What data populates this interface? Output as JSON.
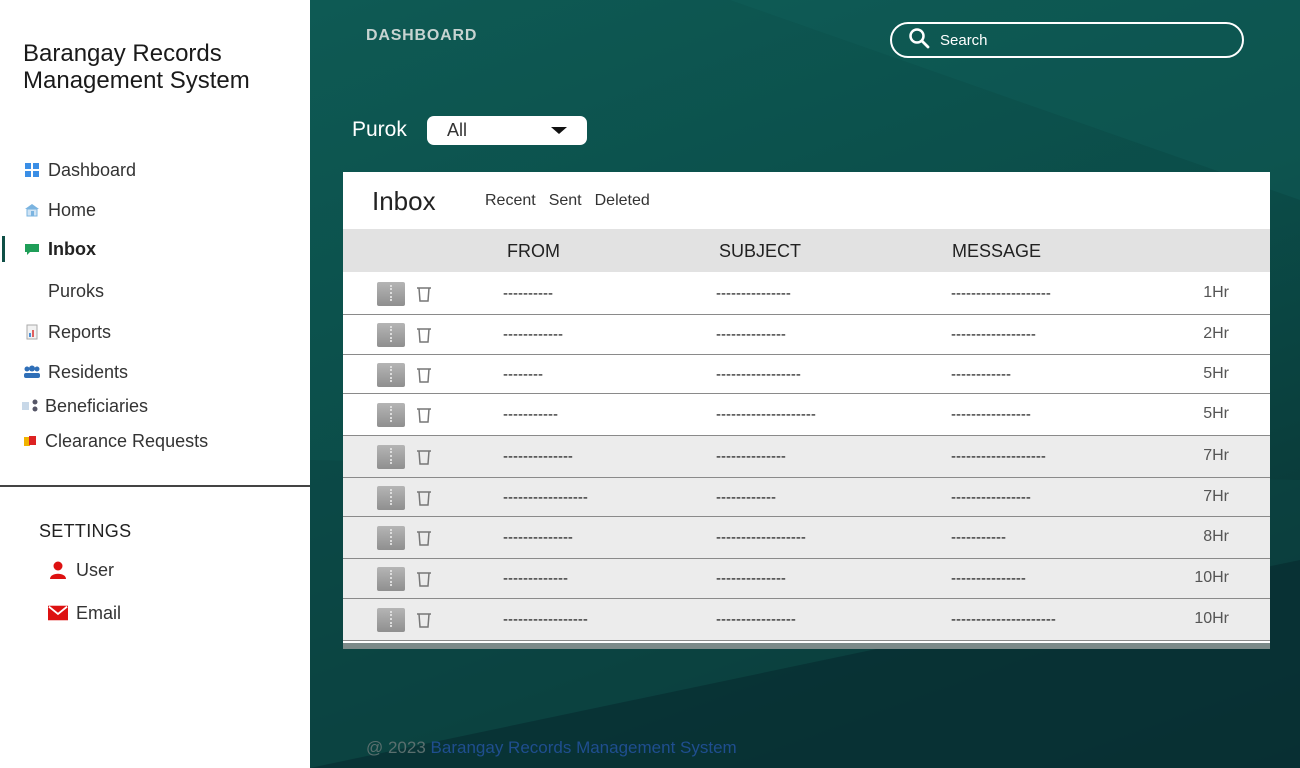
{
  "app": {
    "title_line1": "Barangay Records",
    "title_line2": "Management System"
  },
  "sidebar": {
    "items": [
      {
        "label": "Dashboard",
        "icon": "dashboard-icon"
      },
      {
        "label": "Home",
        "icon": "home-icon"
      },
      {
        "label": "Inbox",
        "icon": "chat-icon",
        "active": true
      },
      {
        "label": "Puroks",
        "icon": ""
      },
      {
        "label": "Reports",
        "icon": "report-icon"
      },
      {
        "label": "Residents",
        "icon": "people-icon"
      },
      {
        "label": "Beneficiaries",
        "icon": "beneficiaries-icon"
      },
      {
        "label": "Clearance Requests",
        "icon": "clearance-icon"
      }
    ],
    "settings": {
      "title": "SETTINGS",
      "items": [
        {
          "label": "User",
          "icon": "user-icon"
        },
        {
          "label": "Email",
          "icon": "mail-icon"
        }
      ]
    }
  },
  "header": {
    "title": "DASHBOARD",
    "search_placeholder": "Search"
  },
  "filter": {
    "label": "Purok",
    "selected": "All"
  },
  "inbox": {
    "title": "Inbox",
    "tabs": [
      "Recent",
      "Sent",
      "Deleted"
    ],
    "columns": [
      "FROM",
      "SUBJECT",
      "MESSAGE"
    ],
    "rows": [
      {
        "from": "----------",
        "subject": "---------------",
        "message": "--------------------",
        "time": "1Hr"
      },
      {
        "from": "------------",
        "subject": "--------------",
        "message": "-----------------",
        "time": "2Hr"
      },
      {
        "from": "--------",
        "subject": "-----------------",
        "message": "------------",
        "time": "5Hr"
      },
      {
        "from": "-----------",
        "subject": "--------------------",
        "message": "----------------",
        "time": "5Hr"
      },
      {
        "from": "--------------",
        "subject": "--------------",
        "message": "-------------------",
        "time": "7Hr"
      },
      {
        "from": "-----------------",
        "subject": "------------",
        "message": "----------------",
        "time": "7Hr"
      },
      {
        "from": "--------------",
        "subject": "------------------",
        "message": "-----------",
        "time": "8Hr"
      },
      {
        "from": "-------------",
        "subject": "--------------",
        "message": "---------------",
        "time": "10Hr"
      },
      {
        "from": "-----------------",
        "subject": "----------------",
        "message": "---------------------",
        "time": "10Hr"
      }
    ]
  },
  "footer": {
    "prefix": "@ 2023",
    "link": "Barangay Records Management System"
  },
  "colors": {
    "accent": "#0f4f46",
    "main_bg": "#0b4d49",
    "row_shade": "#ececec",
    "link": "#1f4e8f"
  }
}
